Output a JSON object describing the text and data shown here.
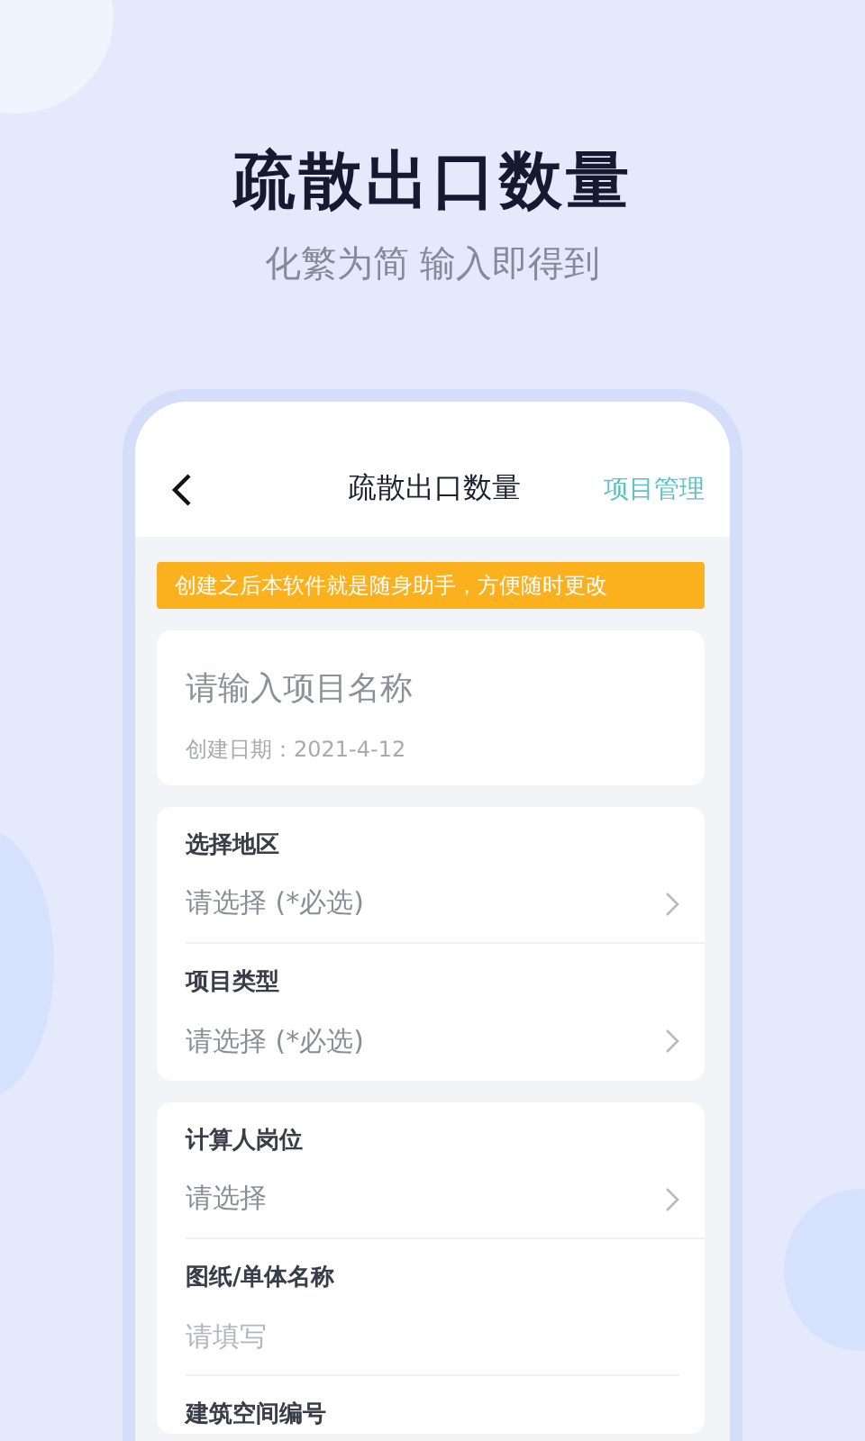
{
  "promo": {
    "headline": "疏散出口数量",
    "tagline": "化繁为简 输入即得到"
  },
  "app": {
    "header": {
      "title": "疏散出口数量",
      "action": "项目管理"
    },
    "notice": "创建之后本软件就是随身助手，方便随时更改",
    "project": {
      "name_placeholder": "请输入项目名称",
      "created": "创建日期：2021-4-12"
    },
    "sections": [
      {
        "fields": [
          {
            "kind": "select",
            "label": "选择地区",
            "value": "请选择 (*必选)"
          },
          {
            "kind": "select",
            "label": "项目类型",
            "value": "请选择 (*必选)"
          }
        ]
      },
      {
        "fields": [
          {
            "kind": "select",
            "label": "计算人岗位",
            "value": "请选择"
          },
          {
            "kind": "input",
            "label": "图纸/单体名称",
            "placeholder": "请填写"
          },
          {
            "kind": "input",
            "label": "建筑空间编号"
          }
        ]
      }
    ]
  }
}
